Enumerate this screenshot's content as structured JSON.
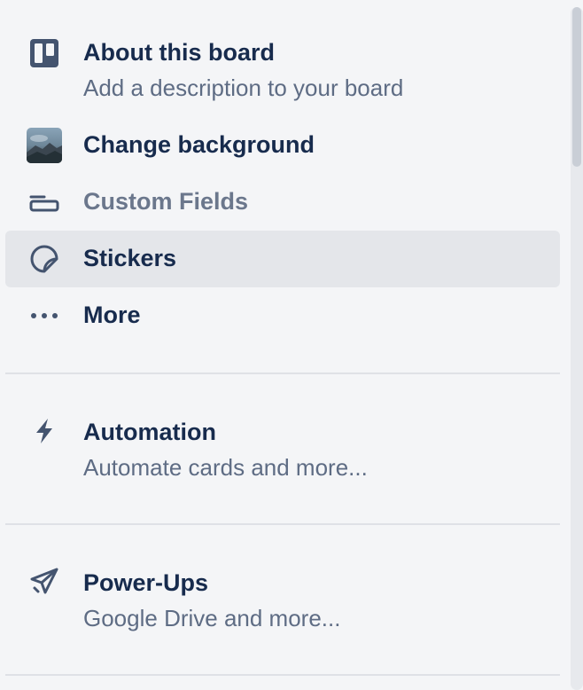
{
  "menu": {
    "about": {
      "title": "About this board",
      "subtitle": "Add a description to your board",
      "icon": "board-icon"
    },
    "background": {
      "title": "Change background",
      "icon": "background-thumbnail"
    },
    "custom_fields": {
      "title": "Custom Fields",
      "icon": "custom-fields-icon"
    },
    "stickers": {
      "title": "Stickers",
      "icon": "sticker-icon"
    },
    "more": {
      "title": "More",
      "icon": "ellipsis-icon"
    },
    "automation": {
      "title": "Automation",
      "subtitle": "Automate cards and more...",
      "icon": "lightning-icon"
    },
    "powerups": {
      "title": "Power-Ups",
      "subtitle": "Google Drive and more...",
      "icon": "rocket-icon"
    }
  },
  "colors": {
    "text_primary": "#172b4d",
    "text_secondary": "#5e6c84",
    "selected_bg": "#e4e6ea",
    "panel_bg": "#f4f5f7"
  }
}
